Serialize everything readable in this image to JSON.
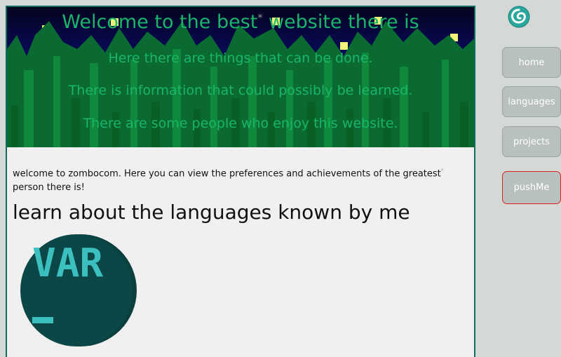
{
  "banner": {
    "title": "Welcome to the best",
    "title_star": "*",
    "title_rest": " website there is",
    "lines": [
      "Here there are things that can be done.",
      "There is information that could possibly be learned.",
      "There are some people who enjoy this website."
    ]
  },
  "intro": {
    "text": "welcome to zombocom. Here you can view the preferences and achievements of the greatest",
    "star": "*",
    "text_rest": " person there is!"
  },
  "section": {
    "heading": "learn about the languages known by me"
  },
  "badge": {
    "label": "VAR"
  },
  "nav": {
    "home": "home",
    "languages": "languages",
    "projects": "projects",
    "pushme": "pushMe"
  },
  "colors": {
    "accent": "#0e6d5c",
    "banner_text": "#19b56a",
    "pushme_border": "#e0201c",
    "button_bg": "#b9c1c0"
  },
  "icons": {
    "logo": "swirl-logo-icon"
  }
}
